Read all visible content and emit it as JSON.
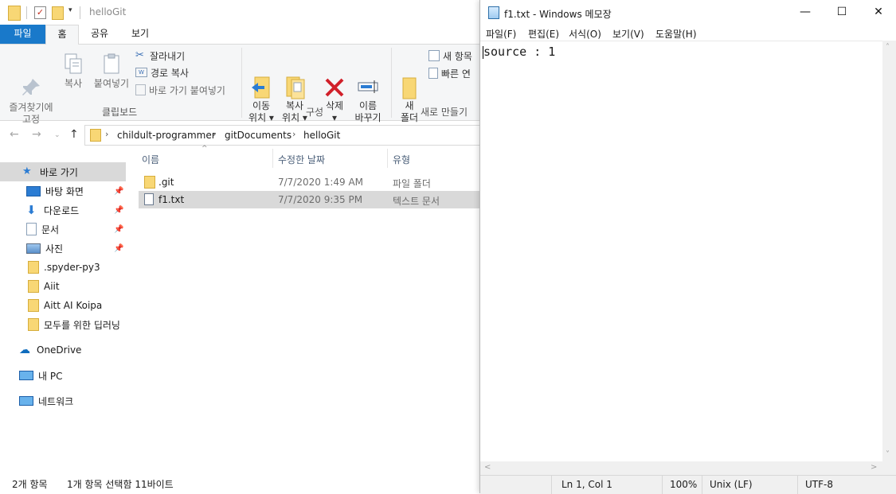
{
  "explorer": {
    "window_title": "helloGit",
    "ribbon_tabs": [
      "파일",
      "홈",
      "공유",
      "보기"
    ],
    "clipboard": {
      "pin_label": "즐겨찾기에\n고정",
      "copy_label": "복사",
      "paste_label": "붙여넣기",
      "cut_label": "잘라내기",
      "copy_path_label": "경로 복사",
      "paste_shortcut_label": "바로 가기 붙여넣기",
      "group_label": "클립보드"
    },
    "organize": {
      "move_label": "이동\n위치 ▾",
      "copy_to_label": "복사\n위치 ▾",
      "delete_label": "삭제\n▾",
      "rename_label": "이름\n바꾸기",
      "group_label": "구성"
    },
    "new": {
      "new_folder_label": "새\n폴더",
      "new_item_label": "새 항목",
      "easy_access_label": "빠른 연",
      "group_label": "새로 만들기"
    },
    "breadcrumb": [
      "childult-programmer",
      "gitDocuments",
      "helloGit"
    ],
    "nav": {
      "quick_access": "바로 가기",
      "items": [
        {
          "label": "바탕 화면",
          "icon": "desktop-icon"
        },
        {
          "label": "다운로드",
          "icon": "download-icon"
        },
        {
          "label": "문서",
          "icon": "documents-icon"
        },
        {
          "label": "사진",
          "icon": "pictures-icon"
        },
        {
          "label": ".spyder-py3",
          "icon": "folder-icon"
        },
        {
          "label": "Aiit",
          "icon": "folder-icon"
        },
        {
          "label": "Aitt AI Koipa",
          "icon": "folder-icon"
        },
        {
          "label": "모두를 위한 딥러닝",
          "icon": "folder-icon"
        }
      ],
      "onedrive": "OneDrive",
      "this_pc": "내 PC",
      "network": "네트워크"
    },
    "columns": [
      "이름",
      "수정한 날짜",
      "유형"
    ],
    "files": [
      {
        "name": ".git",
        "modified": "7/7/2020 1:49 AM",
        "type": "파일 폴더"
      },
      {
        "name": "f1.txt",
        "modified": "7/7/2020 9:35 PM",
        "type": "텍스트 문서"
      }
    ],
    "status": {
      "count": "2개 항목",
      "selection": "1개 항목 선택함 11바이트"
    }
  },
  "notepad": {
    "title": "f1.txt - Windows 메모장",
    "menu": [
      "파일(F)",
      "편집(E)",
      "서식(O)",
      "보기(V)",
      "도움말(H)"
    ],
    "content": "source : 1",
    "status": {
      "position": "Ln 1, Col 1",
      "zoom": "100%",
      "line_ending": "Unix (LF)",
      "encoding": "UTF-8"
    },
    "controls": {
      "minimize": "—",
      "maximize": "☐",
      "close": "✕"
    }
  }
}
